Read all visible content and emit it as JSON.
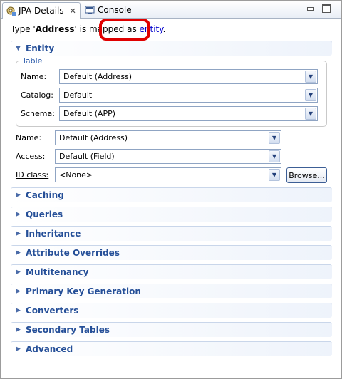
{
  "tabs": [
    {
      "label": "JPA Details",
      "close": "✕",
      "icon": "jpa-details-icon"
    },
    {
      "label": "Console",
      "icon": "console-icon"
    }
  ],
  "header": {
    "prefix": "Type '",
    "type_name": "Address",
    "middle": "' is mapped as ",
    "link": "entity",
    "suffix": "."
  },
  "entity_section": {
    "label": "Entity",
    "table_group": {
      "legend": "Table",
      "name_label": "Name:",
      "name_value": "Default (Address)",
      "catalog_label": "Catalog:",
      "catalog_value": "Default",
      "schema_label": "Schema:",
      "schema_value": "Default (APP)"
    },
    "name_label": "Name:",
    "name_value": "Default (Address)",
    "access_label": "Access:",
    "access_value": "Default (Field)",
    "id_class_label": "ID class:",
    "id_class_value": "<None>",
    "browse_label": "Browse..."
  },
  "sections": [
    {
      "label": "Caching"
    },
    {
      "label": "Queries"
    },
    {
      "label": "Inheritance"
    },
    {
      "label": "Attribute Overrides"
    },
    {
      "label": "Multitenancy"
    },
    {
      "label": "Primary Key Generation"
    },
    {
      "label": "Converters"
    },
    {
      "label": "Secondary Tables"
    },
    {
      "label": "Advanced"
    }
  ],
  "colors": {
    "section_text": "#254f98",
    "link": "#0000cc",
    "highlight": "#e00000"
  }
}
